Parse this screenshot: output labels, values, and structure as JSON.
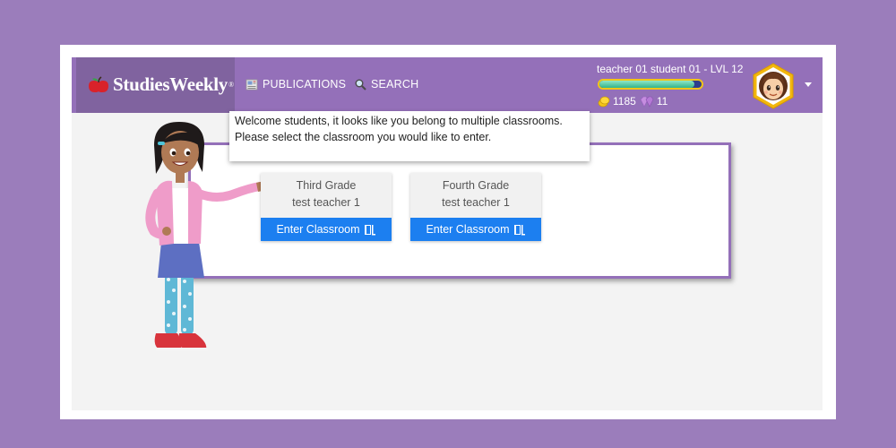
{
  "header": {
    "logo_text": "StudiesWeekly",
    "logo_mark": "®",
    "nav": [
      {
        "label": "PUBLICATIONS",
        "icon": "publications-icon"
      },
      {
        "label": "SEARCH",
        "icon": "search-icon"
      }
    ],
    "user": {
      "name": "teacher 01 student 01 - LVL 12",
      "xp_progress": 0.93,
      "coins": "1185",
      "gems": "11"
    }
  },
  "welcome_message": "Welcome students, it looks like you belong to multiple classrooms. Please select the classroom you would like to enter.",
  "classrooms": [
    {
      "grade": "Third Grade",
      "teacher": "test teacher 1",
      "button": "Enter Classroom"
    },
    {
      "grade": "Fourth Grade",
      "teacher": "test teacher 1",
      "button": "Enter Classroom"
    }
  ],
  "colors": {
    "page_background": "#9b7dbb",
    "header": "#9470b9",
    "logo_box": "#80639f",
    "button": "#1c7ff0",
    "xp_border": "#f2c418"
  }
}
